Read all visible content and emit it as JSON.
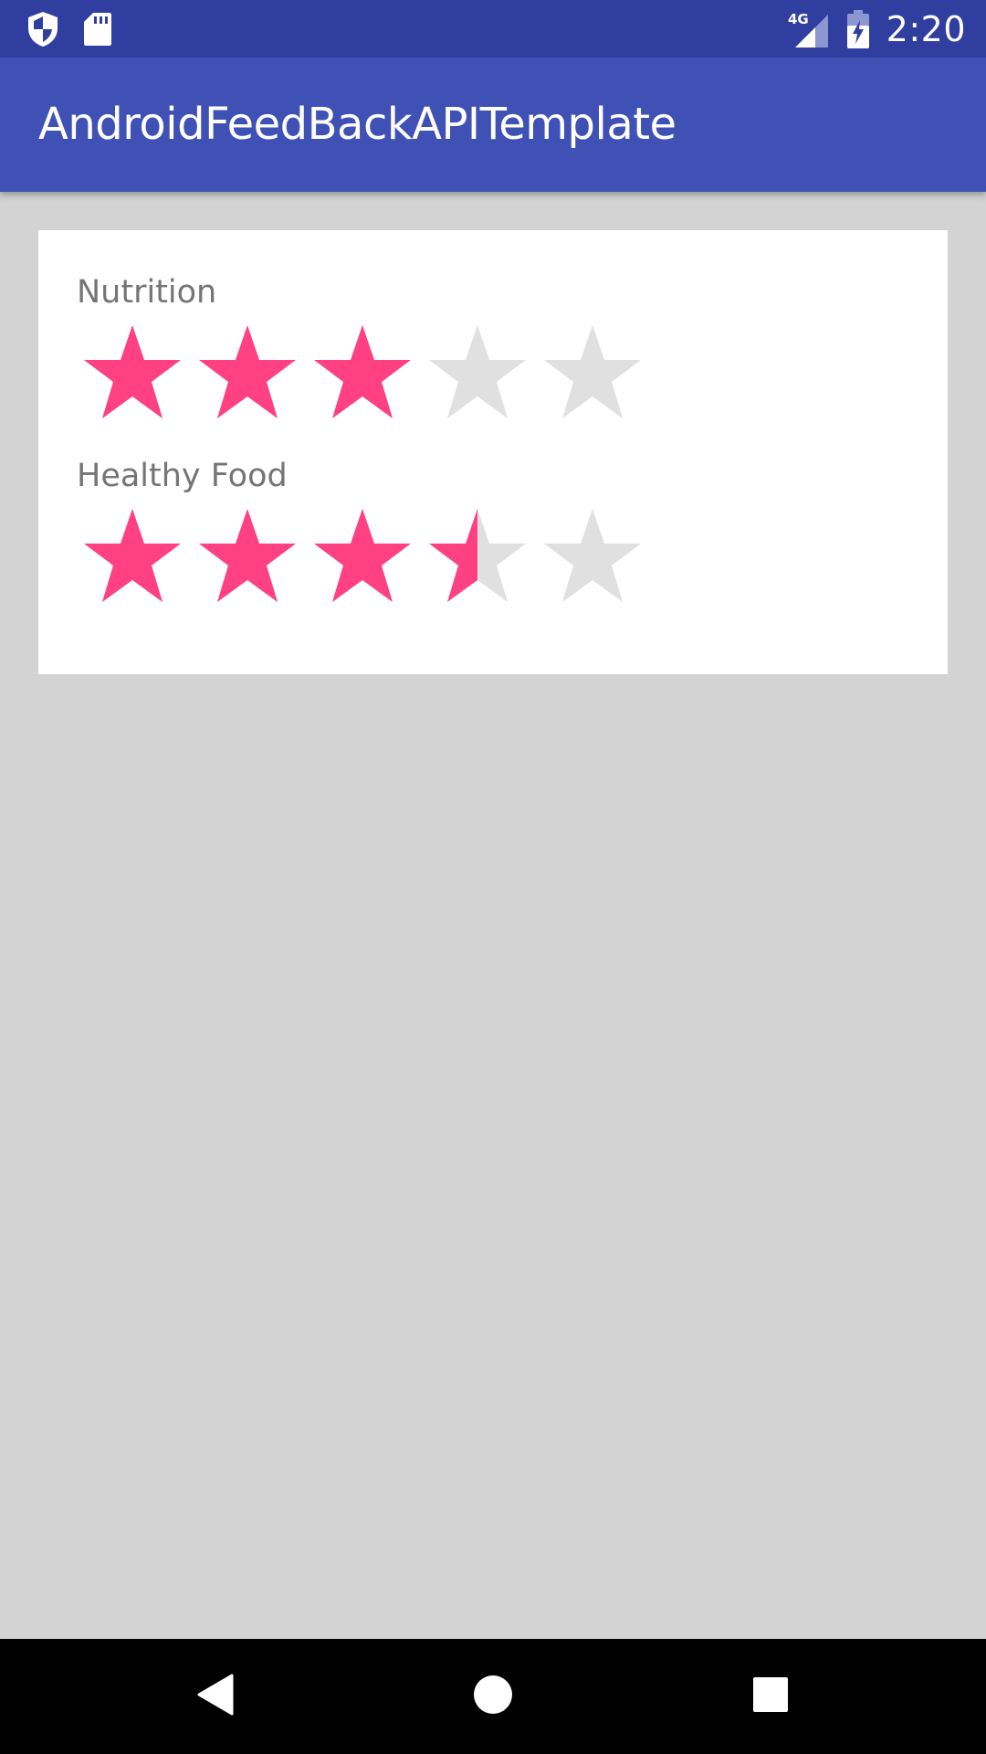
{
  "status_bar": {
    "time": "2:20",
    "network": "4G",
    "icons": [
      "shield-icon",
      "sd-card-icon",
      "signal-4g-icon",
      "battery-charging-icon"
    ],
    "background": "#303F9F"
  },
  "app_bar": {
    "title": "AndroidFeedBackAPITemplate",
    "background": "#3F51B5"
  },
  "ratings": [
    {
      "label": "Nutrition",
      "value": 3.0,
      "max": 5
    },
    {
      "label": "Healthy Food",
      "value": 3.5,
      "max": 5
    }
  ],
  "colors": {
    "star_filled": "#FF4081",
    "star_empty": "#E0E0E0",
    "page_background": "#D3D3D3",
    "card_background": "#FFFFFF",
    "label_text": "#757575"
  },
  "nav_bar": {
    "buttons": [
      "back-icon",
      "home-icon",
      "recents-icon"
    ]
  }
}
